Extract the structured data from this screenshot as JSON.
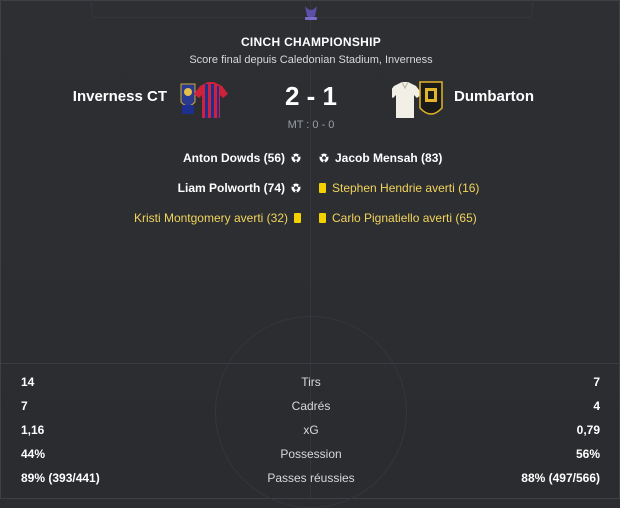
{
  "competition": "CINCH CHAMPIONSHIP",
  "venue": "Score final depuis Caledonian Stadium, Inverness",
  "home": {
    "name": "Inverness CT"
  },
  "away": {
    "name": "Dumbarton"
  },
  "score": "2 - 1",
  "half_time": "MT : 0 - 0",
  "home_events": [
    {
      "type": "goal",
      "text": "Anton Dowds (56)",
      "icon": "ball-icon"
    },
    {
      "type": "goal",
      "text": "Liam Polworth (74)",
      "icon": "ball-icon"
    },
    {
      "type": "card",
      "text": "Kristi Montgomery averti (32)",
      "icon": "yellow-card-icon"
    }
  ],
  "away_events": [
    {
      "type": "goal",
      "text": "Jacob Mensah (83)",
      "icon": "ball-icon"
    },
    {
      "type": "card",
      "text": "Stephen Hendrie averti (16)",
      "icon": "yellow-card-icon"
    },
    {
      "type": "card",
      "text": "Carlo Pignatiello averti (65)",
      "icon": "yellow-card-icon"
    }
  ],
  "stats": [
    {
      "label": "Tirs",
      "home": "14",
      "away": "7"
    },
    {
      "label": "Cadrés",
      "home": "7",
      "away": "4"
    },
    {
      "label": "xG",
      "home": "1,16",
      "away": "0,79"
    },
    {
      "label": "Possession",
      "home": "44%",
      "away": "56%"
    },
    {
      "label": "Passes réussies",
      "home": "89% (393/441)",
      "away": "88% (497/566)"
    }
  ],
  "colors": {
    "background": "#2b2d31",
    "card_text": "#f2d45c",
    "yellow_card": "#f5d000",
    "home_kit_primary": "#d0213a",
    "home_kit_secondary": "#1d2f8f",
    "away_kit_primary": "#f2efe6",
    "away_badge": "#1a1a1a",
    "away_badge_accent": "#e2b528"
  }
}
